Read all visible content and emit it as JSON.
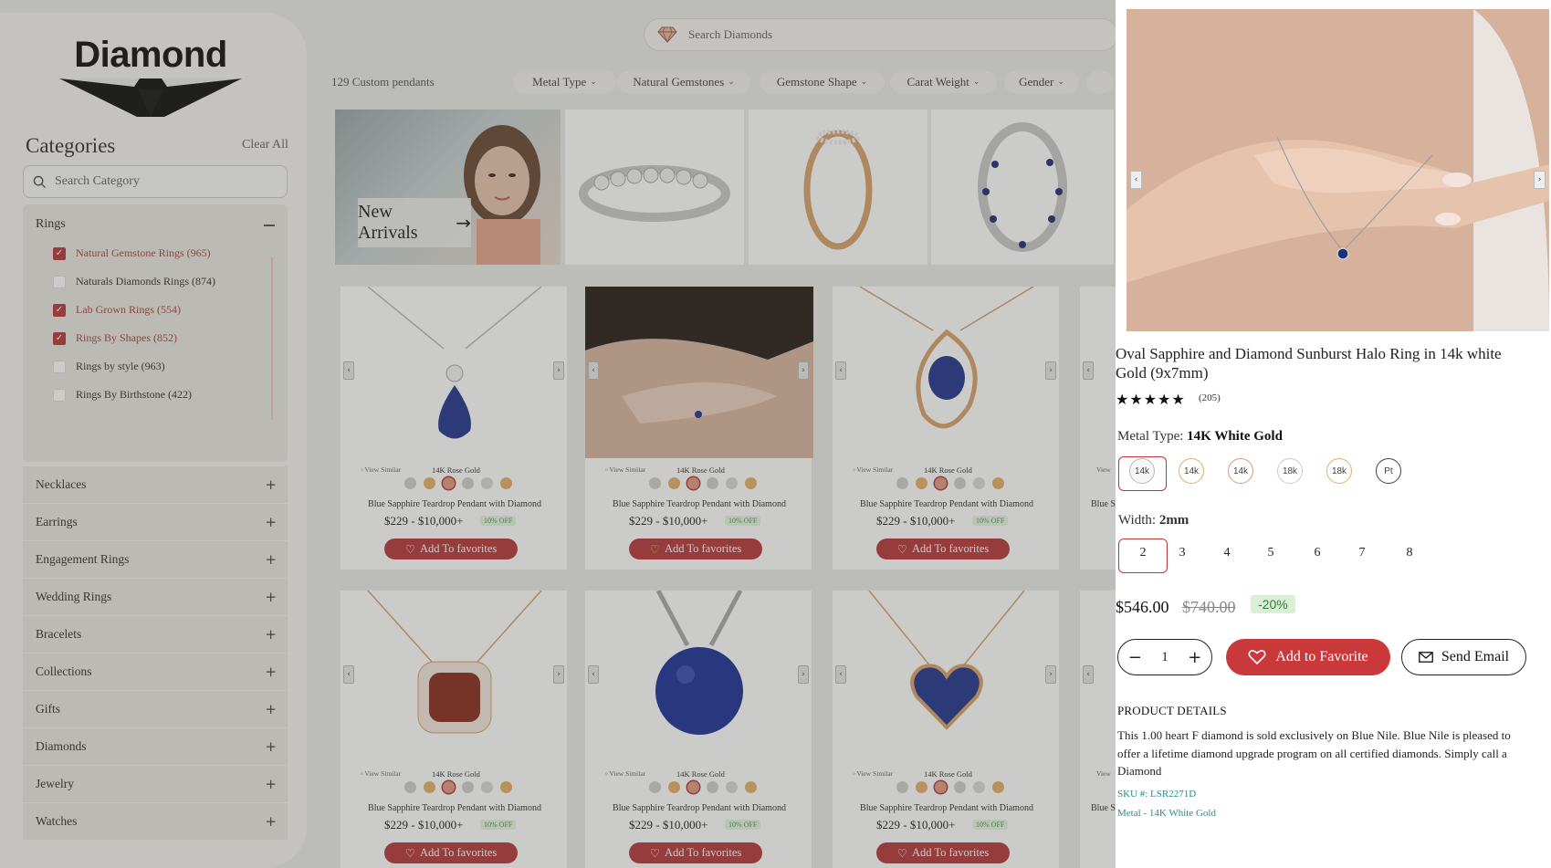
{
  "brand": {
    "name": "Diamond"
  },
  "sidebar": {
    "title": "Categories",
    "clear_all": "Clear All",
    "search_placeholder": "Search Category",
    "rings": {
      "label": "Rings",
      "items": [
        {
          "label": "Natural Gemstone Rings (965)",
          "checked": true
        },
        {
          "label": "Naturals Diamonds Rings (874)",
          "checked": false
        },
        {
          "label": "Lab Grown Rings (554)",
          "checked": true
        },
        {
          "label": "Rings By Shapes (852)",
          "checked": true
        },
        {
          "label": "Rings by style (963)",
          "checked": false
        },
        {
          "label": "Rings By Birthstone (422)",
          "checked": false
        }
      ]
    },
    "categories": [
      "Necklaces",
      "Earrings",
      "Engagement Rings",
      "Wedding Rings",
      "Bracelets",
      "Collections",
      "Gifts",
      "Diamonds",
      "Jewelry",
      "Watches"
    ]
  },
  "search": {
    "placeholder": "Search Diamonds"
  },
  "results": {
    "count_label": "129 Custom pendants"
  },
  "filters": [
    "Metal Type",
    "Natural Gemstones",
    "Gemstone Shape",
    "Carat Weight",
    "Gender"
  ],
  "banner": {
    "label": "New Arrivals"
  },
  "cards": {
    "view_similar": "View Similar",
    "metal": "14K Rose Gold",
    "title": "Blue Sapphire Teardrop Pendant with Diamond",
    "price": "$229 - $10,000+",
    "off": "10% OFF",
    "fav": "Add To favorites",
    "partial_title": "Blue Sa"
  },
  "product": {
    "title": "Oval Sapphire and Diamond Sunburst Halo Ring in 14k white Gold (9x7mm)",
    "reviews": "(205)",
    "rating": 5,
    "metal_label": "Metal Type:",
    "metal_value": "14K White Gold",
    "metal_options": [
      "14k",
      "14k",
      "14k",
      "18k",
      "18k",
      "Pt"
    ],
    "width_label": "Width:",
    "width_value": "2mm",
    "widths": [
      "2",
      "3",
      "4",
      "5",
      "6",
      "7",
      "8"
    ],
    "price": "$546.00",
    "old_price": "$740.00",
    "discount": "-20%",
    "qty": "1",
    "add_fav": "Add to Favorite",
    "send_email": "Send Email",
    "details_heading": "PRODUCT DETAILS",
    "details": "This 1.00 heart F diamond is sold exclusively on Blue Nile. Blue Nile is pleased to offer a lifetime diamond upgrade program on all certified diamonds. Simply call a Diamond",
    "sku": "SKU #: LSR2271D",
    "metal_spec": "Metal - 14K White Gold"
  },
  "colors": {
    "accent": "#b8393c",
    "teal": "#2a8a8a"
  }
}
